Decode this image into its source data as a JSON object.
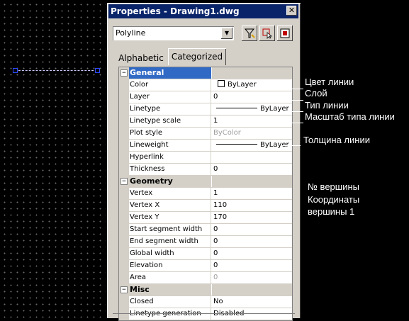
{
  "window": {
    "title": "Properties - Drawing1.dwg",
    "close_glyph": "✕"
  },
  "toolbar": {
    "object_type": "Polyline",
    "quick_select_icon": "quick-select-icon",
    "select_objects_icon": "select-objects-icon",
    "pickadd_icon": "pickadd-toggle-icon"
  },
  "tabs": [
    {
      "label": "Alphabetic",
      "active": false
    },
    {
      "label": "Categorized",
      "active": true
    }
  ],
  "categories": [
    {
      "name": "General",
      "selected": true,
      "properties": [
        {
          "name": "Color",
          "value": "ByLayer"
        },
        {
          "name": "Layer",
          "value": "0"
        },
        {
          "name": "Linetype",
          "value": "ByLayer"
        },
        {
          "name": "Linetype scale",
          "value": "1"
        },
        {
          "name": "Plot style",
          "value": "ByColor"
        },
        {
          "name": "Lineweight",
          "value": "ByLayer"
        },
        {
          "name": "Hyperlink",
          "value": ""
        },
        {
          "name": "Thickness",
          "value": "0"
        }
      ]
    },
    {
      "name": "Geometry",
      "selected": false,
      "properties": [
        {
          "name": "Vertex",
          "value": "1"
        },
        {
          "name": "Vertex X",
          "value": "110"
        },
        {
          "name": "Vertex Y",
          "value": "170"
        },
        {
          "name": "Start segment width",
          "value": "0"
        },
        {
          "name": "End segment width",
          "value": "0"
        },
        {
          "name": "Global width",
          "value": "0"
        },
        {
          "name": "Elevation",
          "value": "0"
        },
        {
          "name": "Area",
          "value": "0"
        }
      ]
    },
    {
      "name": "Misc",
      "selected": false,
      "properties": [
        {
          "name": "Closed",
          "value": "No"
        },
        {
          "name": "Linetype generation",
          "value": "Disabled"
        }
      ]
    }
  ],
  "annotations": {
    "color": "Цвет линии",
    "layer": "Слой",
    "linetype": "Тип линии",
    "linetype_scale": "Масштаб типа линии",
    "lineweight": "Толщина линии",
    "vertex": "№ вершины",
    "coords_line1": "Координаты",
    "coords_line2": "вершины 1"
  },
  "colors": {
    "titlebar": "#0a246a",
    "selection": "#316ac5",
    "panel": "#d4d0c8",
    "canvas": "#000000",
    "grip": "#2b4bff"
  }
}
